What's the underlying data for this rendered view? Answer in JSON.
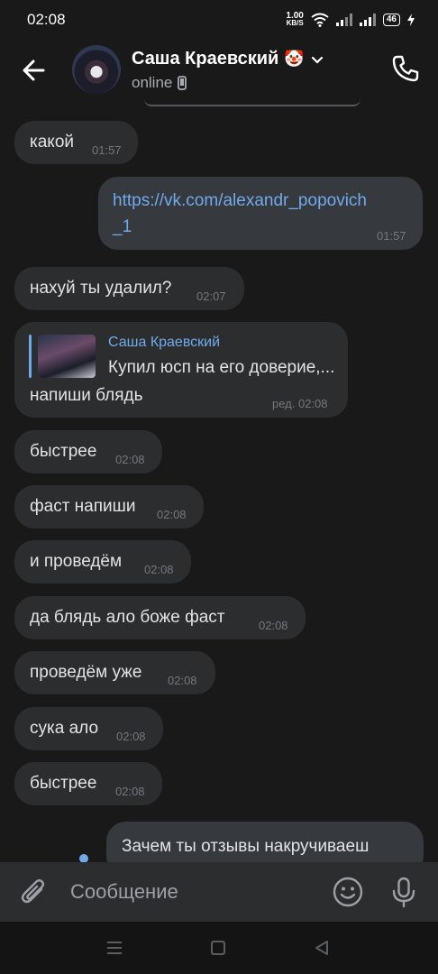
{
  "statusbar": {
    "time": "02:08",
    "net_speed_value": "1.00",
    "net_speed_unit": "KB/S",
    "battery": "46"
  },
  "header": {
    "contact_name": "Саша Краевский",
    "contact_emoji": "🤡",
    "status": "online"
  },
  "messages": [
    {
      "dir": "in",
      "text": "какой",
      "time": "01:57"
    },
    {
      "dir": "out",
      "link_line1": "https://vk.com/alexandr_popovich",
      "link_line2": "_1",
      "time": "01:57"
    },
    {
      "dir": "in",
      "text": "нахуй ты удалил?",
      "time": "02:07"
    },
    {
      "dir": "in",
      "reply_author": "Саша Краевский",
      "reply_text": "Купил юсп на его доверие,...",
      "text": "напиши блядь",
      "time": "ред. 02:08"
    },
    {
      "dir": "in",
      "text": "быстрее",
      "time": "02:08"
    },
    {
      "dir": "in",
      "text": "фаст напиши",
      "time": "02:08"
    },
    {
      "dir": "in",
      "text": "и проведём",
      "time": "02:08"
    },
    {
      "dir": "in",
      "text": "да блядь ало боже фаст",
      "time": "02:08"
    },
    {
      "dir": "in",
      "text": "проведём уже",
      "time": "02:08"
    },
    {
      "dir": "in",
      "text": "сука ало",
      "time": "02:08"
    },
    {
      "dir": "in",
      "text": "быстрее",
      "time": "02:08"
    },
    {
      "dir": "out",
      "text": "Зачем ты отзывы накручиваеш"
    }
  ],
  "composer": {
    "placeholder": "Сообщение"
  },
  "icons": {
    "back": "arrow-left-icon",
    "call": "phone-icon",
    "status_device": "mobile-icon",
    "attach": "paperclip-icon",
    "emoji": "smile-icon",
    "mic": "microphone-icon"
  },
  "colors": {
    "background": "#19191a",
    "bubble_in": "#2c2d2f",
    "bubble_out": "#36393e",
    "link": "#71aaeb",
    "time": "#74777c"
  }
}
